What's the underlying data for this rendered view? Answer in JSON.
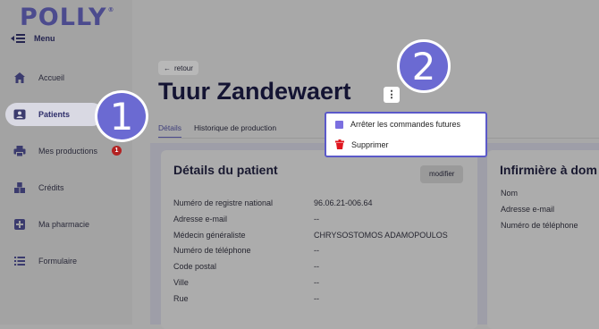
{
  "app": {
    "logo_text": "POLLY",
    "logo_mark": "®",
    "menu_label": "Menu"
  },
  "sidebar": {
    "items": [
      {
        "label": "Accueil",
        "icon": "home-icon"
      },
      {
        "label": "Patients",
        "icon": "user-card-icon"
      },
      {
        "label": "Mes productions",
        "icon": "printer-icon",
        "badge": "1"
      },
      {
        "label": "Crédits",
        "icon": "credits-icon"
      },
      {
        "label": "Ma pharmacie",
        "icon": "plus-cross-icon"
      },
      {
        "label": "Formulaire",
        "icon": "list-icon"
      }
    ]
  },
  "header": {
    "back_label": "retour",
    "patient_name": "Tuur Zandewaert",
    "more_label": "⋮"
  },
  "tabs": [
    {
      "label": "Détails"
    },
    {
      "label": "Historique de production"
    }
  ],
  "dropdown": {
    "items": [
      {
        "label": "Arrêter les commandes futures",
        "icon": "stop-square-icon"
      },
      {
        "label": "Supprimer",
        "icon": "trash-icon"
      }
    ]
  },
  "patient_details": {
    "title": "Détails du patient",
    "modify_label": "modifier",
    "fields": [
      {
        "label": "Numéro de registre national",
        "value": "96.06.21-006.64"
      },
      {
        "label": "Adresse e-mail",
        "value": "--"
      },
      {
        "label": "Médecin généraliste",
        "value": "CHRYSOSTOMOS ADAMOPOULOS"
      },
      {
        "label": "Numéro de téléphone",
        "value": "--"
      },
      {
        "label": "Code postal",
        "value": "--"
      },
      {
        "label": "Ville",
        "value": "--"
      },
      {
        "label": "Rue",
        "value": "--"
      }
    ]
  },
  "nurse": {
    "title": "Infirmière à dom",
    "fields": [
      "Nom",
      "Adresse e-mail",
      "Numéro de téléphone"
    ]
  },
  "annotations": {
    "step1": "1",
    "step2": "2"
  },
  "colors": {
    "accent": "#6b6ad2",
    "brand": "#4c4b8e",
    "danger": "#b32222"
  }
}
